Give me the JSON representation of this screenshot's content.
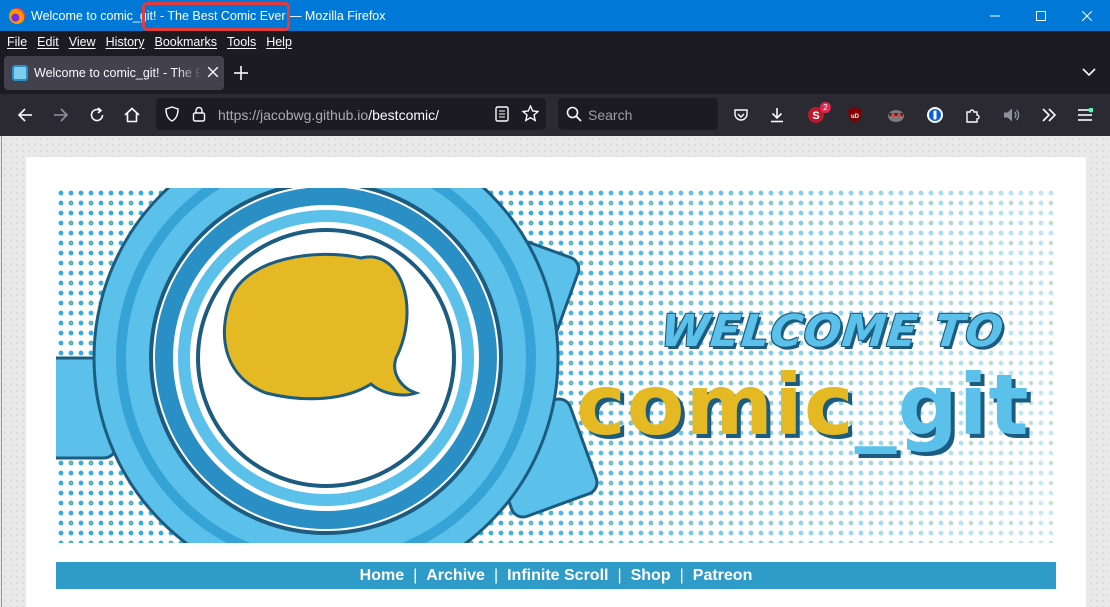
{
  "window": {
    "title": "Welcome to comic_git! - The Best Comic Ever — Mozilla Firefox",
    "controls": [
      "minimize",
      "maximize",
      "close"
    ]
  },
  "menubar": {
    "items": [
      "File",
      "Edit",
      "View",
      "History",
      "Bookmarks",
      "Tools",
      "Help"
    ]
  },
  "tabs": [
    {
      "title": "Welcome to comic_git! - The Best Comic Ever",
      "active": true
    }
  ],
  "toolbar": {
    "url_host": "https://jacobwg.github.io",
    "url_path": "/bestcomic/",
    "search_placeholder": "Search",
    "extension_badge": "2"
  },
  "banner": {
    "welcome_text": "WELCOME TO",
    "logo_part1": "comic",
    "logo_part2": "_git"
  },
  "site_nav": {
    "links": [
      "Home",
      "Archive",
      "Infinite Scroll",
      "Shop",
      "Patreon"
    ],
    "separator": "|"
  },
  "colors": {
    "titlebar": "#0078d7",
    "chrome_dark": "#1c1b22",
    "toolbar": "#2b2a33",
    "nav_strip": "#2f9bc8",
    "gear_blue": "#5cc1ea",
    "bubble_yellow": "#e4b923",
    "highlight": "#e23b3b"
  }
}
